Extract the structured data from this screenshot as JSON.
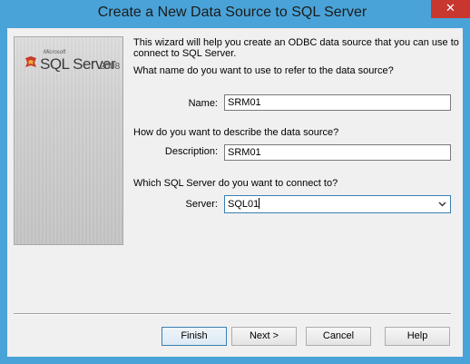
{
  "window": {
    "title": "Create a New Data Source to SQL Server",
    "close_glyph": "✕"
  },
  "logo": {
    "maker": "Microsoft",
    "product": "SQL Server",
    "version": "2008"
  },
  "intro": {
    "line1": "This wizard will help you create an ODBC data source that you can use to",
    "line2": "connect to SQL Server."
  },
  "name_section": {
    "question": "What name do you want to use to refer to the data source?",
    "label": "Name:",
    "value": "SRM01"
  },
  "description_section": {
    "question": "How do you want to describe the data source?",
    "label": "Description:",
    "value": "SRM01"
  },
  "server_section": {
    "question": "Which SQL Server do you want to connect to?",
    "label": "Server:",
    "value": "SQL01",
    "dropdown_icon": "chevron-down-icon"
  },
  "buttons": {
    "finish": "Finish",
    "next": "Next >",
    "cancel": "Cancel",
    "help": "Help"
  },
  "colors": {
    "title_bar": "#4aa3d8",
    "close_button": "#c7372f",
    "dialog_background": "#f0f0f0",
    "focus_border": "#3c7fb1"
  }
}
